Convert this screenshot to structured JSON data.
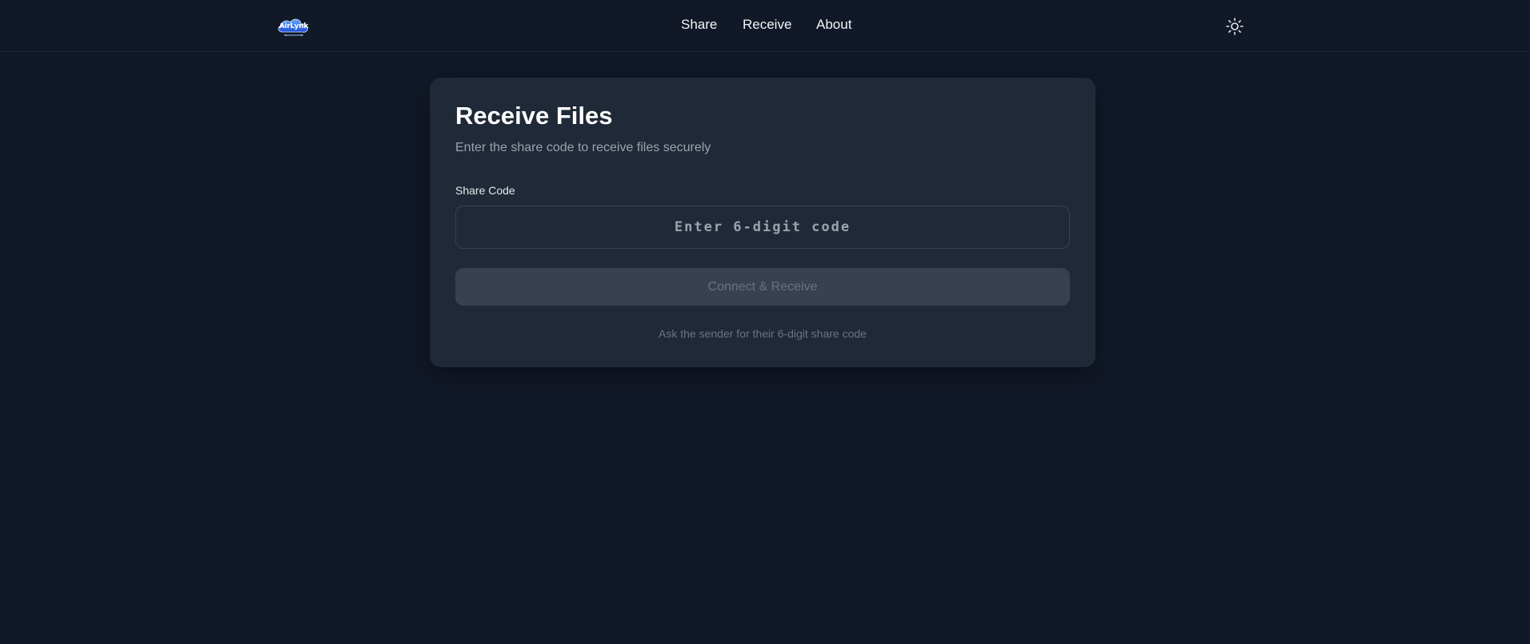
{
  "header": {
    "logo_text": "AirLynk",
    "nav": [
      {
        "label": "Share"
      },
      {
        "label": "Receive"
      },
      {
        "label": "About"
      }
    ],
    "theme_toggle_icon": "sun-icon"
  },
  "receive_card": {
    "title": "Receive Files",
    "subtitle": "Enter the share code to receive files securely",
    "field_label": "Share Code",
    "code_input": {
      "value": "",
      "placeholder": "Enter 6-digit code"
    },
    "connect_label": "Connect & Receive",
    "hint": "Ask the sender for their 6-digit share code"
  },
  "colors": {
    "background": "#111827",
    "card": "#1f2937",
    "button_disabled": "#374151",
    "muted_text": "#9ca3af",
    "logo_blue": "#3b82f6"
  }
}
